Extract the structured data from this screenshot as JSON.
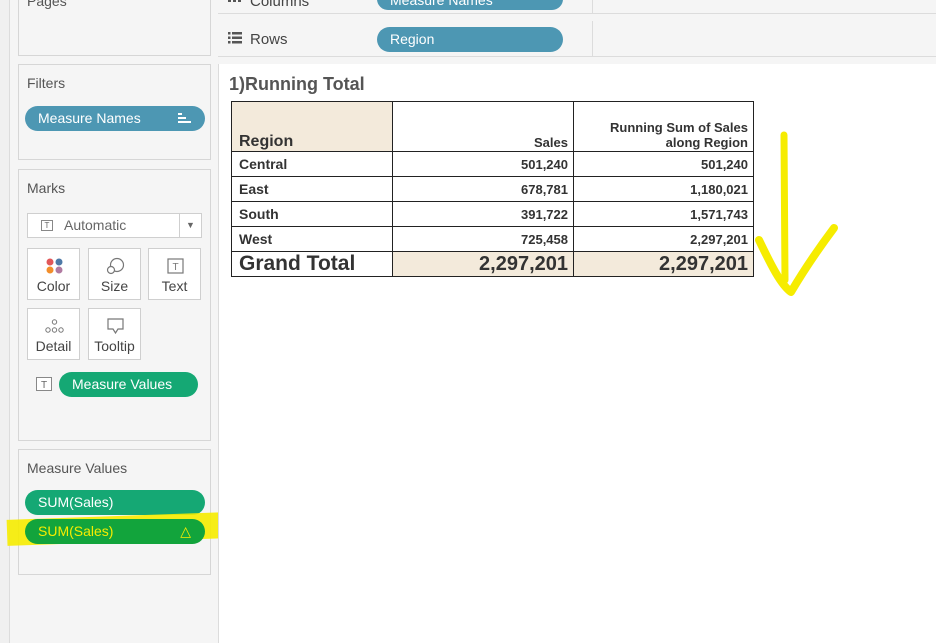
{
  "shelves": {
    "pages_label": "Pages",
    "columns_label": "Columns",
    "columns_pill": "Measure Names",
    "rows_label": "Rows",
    "rows_pill": "Region"
  },
  "filters": {
    "title": "Filters",
    "pill": "Measure Names"
  },
  "marks": {
    "title": "Marks",
    "type_selected": "Automatic",
    "buttons": [
      "Color",
      "Size",
      "Text",
      "Detail",
      "Tooltip"
    ],
    "text_pill": "Measure Values"
  },
  "measure_values": {
    "title": "Measure Values",
    "pills": [
      "SUM(Sales)",
      "SUM(Sales)"
    ],
    "delta_icon": "△"
  },
  "view": {
    "title": "1)Running Total",
    "headers": {
      "region": "Region",
      "sales": "Sales",
      "running_line1": "Running Sum of Sales",
      "running_line2": "along Region"
    },
    "rows": [
      {
        "region": "Central",
        "sales": "501,240",
        "running": "501,240"
      },
      {
        "region": "East",
        "sales": "678,781",
        "running": "1,180,021"
      },
      {
        "region": "South",
        "sales": "391,722",
        "running": "1,571,743"
      },
      {
        "region": "West",
        "sales": "725,458",
        "running": "2,297,201"
      }
    ],
    "grand_total": {
      "label": "Grand Total",
      "sales": "2,297,201",
      "running": "2,297,201"
    }
  },
  "colors": {
    "pill_blue": "#4d97b3",
    "pill_green": "#15a874",
    "header_tan": "#f3eadb",
    "highlighter": "#f6ec00"
  }
}
